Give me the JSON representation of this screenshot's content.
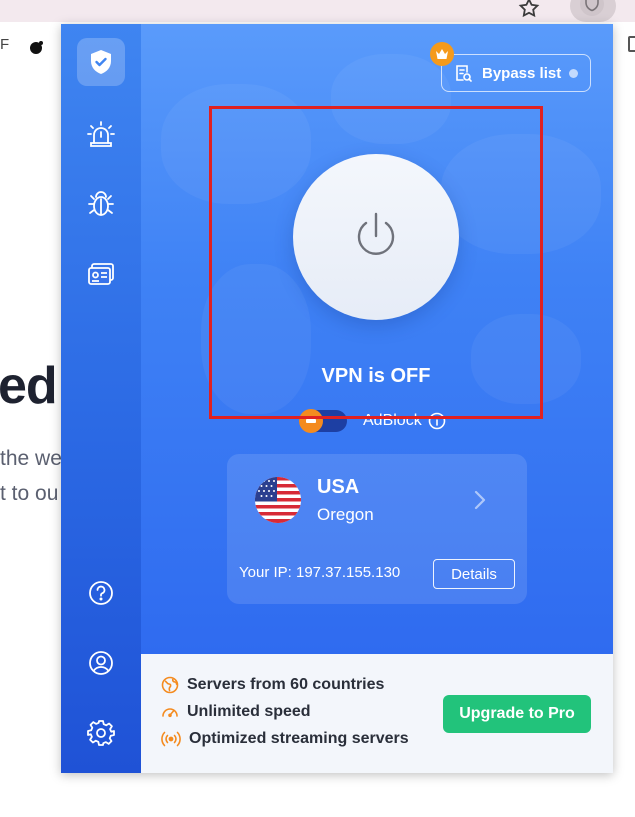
{
  "browser": {
    "toolbar_left_text": "F",
    "extension_icon": "shield-extension-icon",
    "star_icon": "star-icon"
  },
  "background_page": {
    "heading_fragment": "ed",
    "line1": "the we",
    "line2": "t to ou"
  },
  "popup": {
    "sidebar": {
      "items": [
        {
          "icon": "shield-check-icon",
          "active": true
        },
        {
          "icon": "alarm-siren-icon",
          "active": false
        },
        {
          "icon": "bug-icon",
          "active": false
        },
        {
          "icon": "id-card-icon",
          "active": false
        }
      ],
      "bottom_items": [
        {
          "icon": "help-icon"
        },
        {
          "icon": "account-icon"
        },
        {
          "icon": "settings-gear-icon"
        }
      ]
    },
    "bypass": {
      "label": "Bypass list",
      "badge_icon": "crown-icon"
    },
    "vpn": {
      "status": "VPN is OFF",
      "power_icon": "power-icon"
    },
    "adblock": {
      "label": "AdBlock",
      "enabled": false
    },
    "location": {
      "country": "USA",
      "region": "Oregon",
      "flag": "us-flag",
      "ip_text": "Your IP: 197.37.155.130",
      "details_label": "Details"
    },
    "promo": {
      "features": [
        {
          "text": "Servers from 60 countries",
          "icon": "globe-icon"
        },
        {
          "text": "Unlimited speed",
          "icon": "speedometer-icon"
        },
        {
          "text": "Optimized streaming servers",
          "icon": "broadcast-icon"
        }
      ],
      "upgrade_label": "Upgrade to Pro"
    }
  },
  "colors": {
    "main_blue": "#3f82f5",
    "accent_orange": "#f48b1f",
    "upgrade_green": "#22c37b",
    "highlight_red": "#e02121"
  }
}
